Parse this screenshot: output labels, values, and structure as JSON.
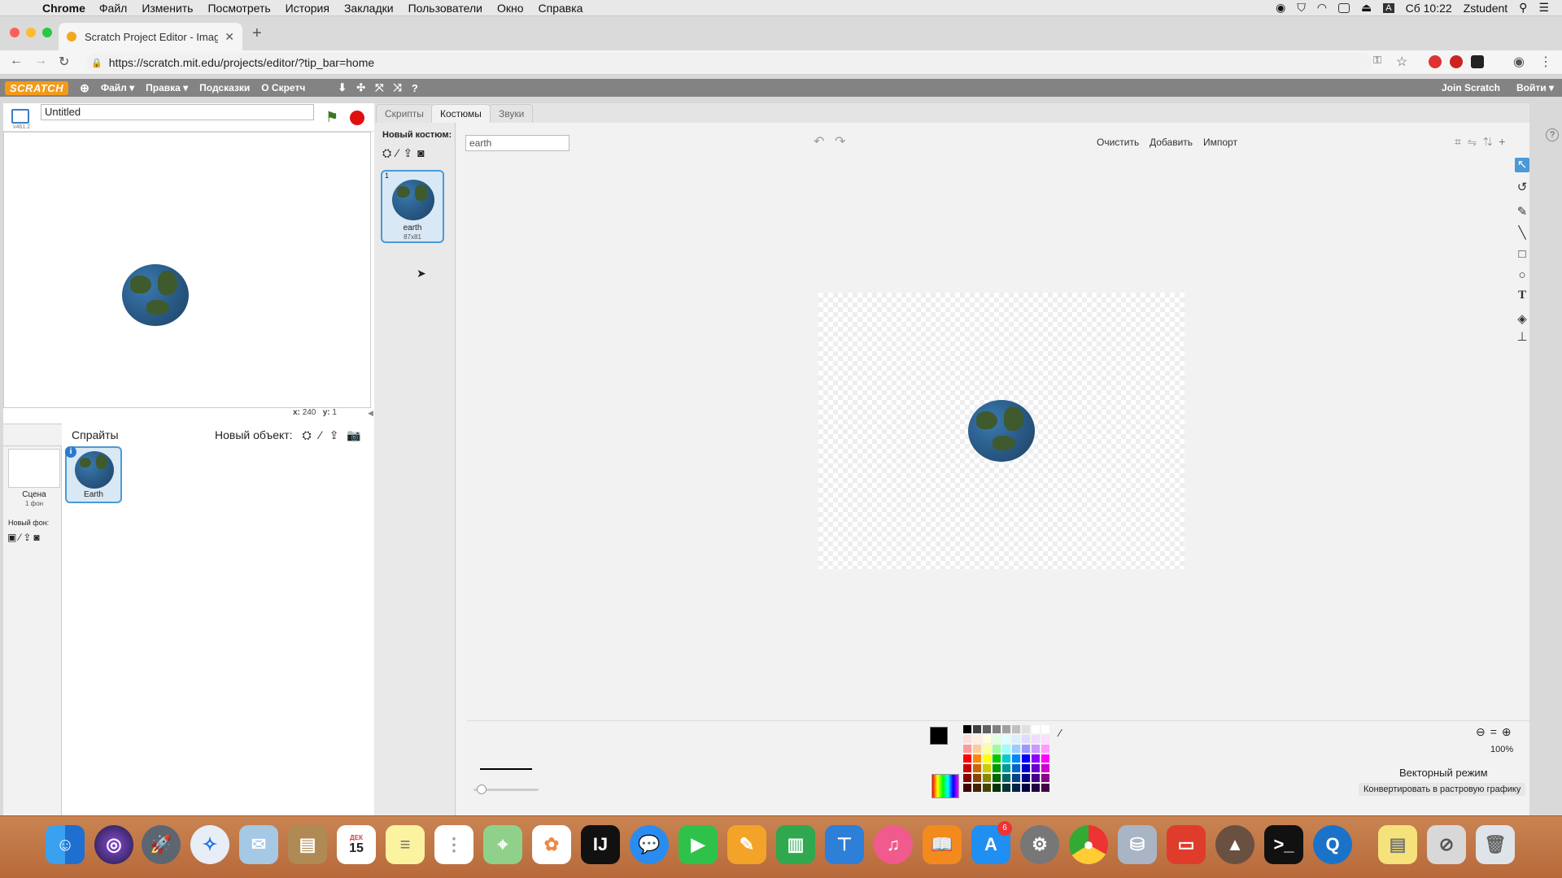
{
  "menubar": {
    "app": "Chrome",
    "items": [
      "Файл",
      "Изменить",
      "Посмотреть",
      "История",
      "Закладки",
      "Пользователи",
      "Окно",
      "Справка"
    ],
    "clock": "Сб 10:22",
    "user": "Zstudent"
  },
  "browser": {
    "tab_title": "Scratch Project Editor - Imagin",
    "url": "https://scratch.mit.edu/projects/editor/?tip_bar=home"
  },
  "scratch_menu": {
    "logo": "SCRATCH",
    "file": "Файл ▾",
    "edit": "Правка ▾",
    "tips": "Подсказки",
    "about": "О Скретч",
    "join": "Join Scratch",
    "signin": "Войти ▾"
  },
  "stage": {
    "version": "v461.2",
    "project_title": "Untitled",
    "coords_x_label": "x:",
    "coords_x": "240",
    "coords_y_label": "y:",
    "coords_y": "1"
  },
  "sprites_panel": {
    "title": "Спрайты",
    "new_object": "Новый объект:",
    "scene_label": "Сцена",
    "scene_count": "1 фон",
    "new_backdrop": "Новый фон:",
    "sprite_name": "Earth"
  },
  "tabs": {
    "scripts": "Скрипты",
    "costumes": "Костюмы",
    "sounds": "Звуки"
  },
  "costumes": {
    "new_costume": "Новый костюм:",
    "index": "1",
    "name": "earth",
    "size": "87x81"
  },
  "editor": {
    "costume_name": "earth",
    "clear": "Очистить",
    "add": "Добавить",
    "import": "Импорт",
    "zoom": "100%",
    "mode": "Векторный режим",
    "convert": "Конвертировать в растровую графику"
  },
  "dock": {
    "calendar_month": "ДЕК",
    "calendar_day": "15",
    "appstore_badge": "6"
  }
}
